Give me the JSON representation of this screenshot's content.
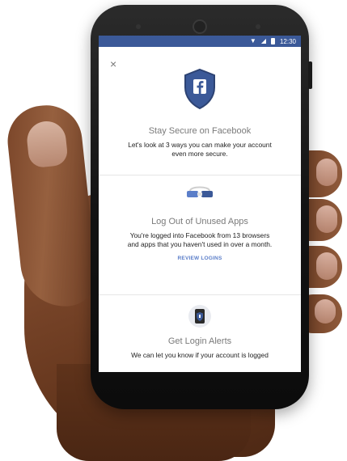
{
  "status_bar": {
    "time": "12:30",
    "icons": [
      "wifi-icon",
      "signal-icon",
      "battery-icon"
    ],
    "color": "#3b5998"
  },
  "close_icon": "×",
  "sections": [
    {
      "icon": "facebook-shield-icon",
      "title": "Stay Secure on Facebook",
      "body": "Let's look at 3 ways you can make your account even more secure."
    },
    {
      "icon": "apps-icon",
      "title": "Log Out of Unused Apps",
      "body": "You're logged into Facebook from 13 browsers and apps that you haven't used in over a month.",
      "link": "REVIEW LOGINS"
    },
    {
      "icon": "login-alerts-icon",
      "title": "Get Login Alerts",
      "body": "We can let you know if your account is logged"
    }
  ],
  "colors": {
    "facebook_blue": "#3b5998",
    "link_blue": "#5b7ec9"
  }
}
